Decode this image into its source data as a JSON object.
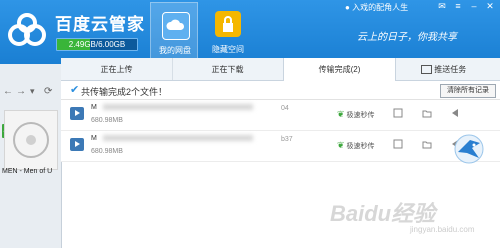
{
  "app": {
    "title": "百度云管家",
    "quota": "2.49GB/6.00GB",
    "quota_fraction": 0.415,
    "user": "入戏的配角人生",
    "slogan": "云上的日子，你我共享"
  },
  "nav": [
    {
      "label": "我的网盘",
      "icon": "cloud-icon"
    },
    {
      "label": "隐藏空间",
      "icon": "lock-icon"
    }
  ],
  "left": {
    "collapse_label": "收起",
    "thumb_label": "MEN - Men of U"
  },
  "tabs": [
    "正在上传",
    "正在下载",
    "传输完成(2)"
  ],
  "push_tab": "推送任务",
  "banner": {
    "text": "共传输完成2个文件！",
    "clear": "清除所有记录"
  },
  "files": [
    {
      "name": "M",
      "size": "680.98MB",
      "ver": "04",
      "speed": "极速秒传"
    },
    {
      "name": "M",
      "size": "680.98MB",
      "ver": "b37",
      "speed": "极速秒传"
    }
  ],
  "watermark": "Baidu经验",
  "watermark_sub": "jingyan.baidu.com",
  "colors": {
    "header": "#1a7fd3",
    "accent": "#3aa63a"
  }
}
